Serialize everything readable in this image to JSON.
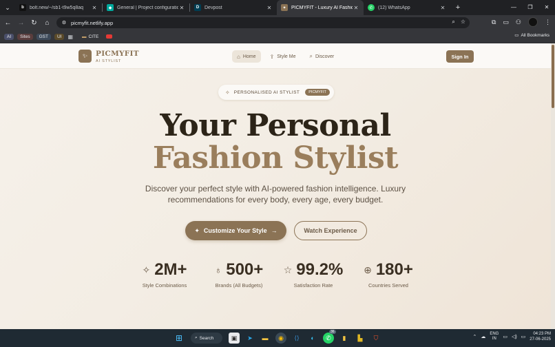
{
  "browser": {
    "tabs": [
      {
        "title": "bolt.new/~/sb1-t9w5q8aq",
        "favicon": "bolt-icon",
        "color": "#111111",
        "glyph": "b",
        "active": false
      },
      {
        "title": "General | Project configuration",
        "favicon": "diamond-icon",
        "color": "#00a99d",
        "glyph": "◆",
        "active": false
      },
      {
        "title": "Devpost",
        "favicon": "devpost-icon",
        "color": "#003e54",
        "glyph": "D",
        "active": false
      },
      {
        "title": "PICMYFIT - Luxury AI Fashion Ir",
        "favicon": "picmyfit-icon",
        "color": "#8b7355",
        "glyph": "✦",
        "active": true
      },
      {
        "title": "(12) WhatsApp",
        "favicon": "whatsapp-icon",
        "color": "#25d366",
        "glyph": "✆",
        "active": false
      }
    ],
    "url": "picmyfit.netlify.app",
    "bookmarks": [
      "AI",
      "Sites",
      "GST",
      "UI"
    ],
    "bookmark_folder": "CITE",
    "all_bookmarks": "All Bookmarks"
  },
  "site": {
    "brand": "PICMYFIT",
    "brand_sub": "AI STYLIST",
    "nav": [
      {
        "label": "Home",
        "icon": "home-icon",
        "glyph": "⌂",
        "active": true
      },
      {
        "label": "Style Me",
        "icon": "upload-icon",
        "glyph": "⇪",
        "active": false
      },
      {
        "label": "Discover",
        "icon": "search-icon",
        "glyph": "⌕",
        "active": false
      }
    ],
    "signin": "Sign In"
  },
  "hero": {
    "badge_text": "PERSONALISED AI STYLIST",
    "badge_pill": "PICMYFIT",
    "title_line1": "Your Personal",
    "title_line2": "Fashion Stylist",
    "description": "Discover your perfect style with AI-powered fashion intelligence. Luxury recommendations for every body, every age, every budget.",
    "primary_cta": "Customize Your Style",
    "secondary_cta": "Watch Experience"
  },
  "stats": [
    {
      "value": "2M+",
      "label": "Style Combinations",
      "icon": "sparkles-icon",
      "glyph": "✧"
    },
    {
      "value": "500+",
      "label": "Brands (All Budgets)",
      "icon": "award-icon",
      "glyph": "♁"
    },
    {
      "value": "99.2%",
      "label": "Satisfaction Rate",
      "icon": "star-icon",
      "glyph": "☆"
    },
    {
      "value": "180+",
      "label": "Countries Served",
      "icon": "globe-icon",
      "glyph": "⊕"
    }
  ],
  "taskbar": {
    "search_label": "Search",
    "whatsapp_badge": "36",
    "lang_line1": "ENG",
    "lang_line2": "IN",
    "time": "04:23 PM",
    "date": "27-06-2025"
  },
  "colors": {
    "accent": "#8b7355",
    "heading_dark": "#2c2418",
    "heading_gold": "#9a7e5c"
  }
}
